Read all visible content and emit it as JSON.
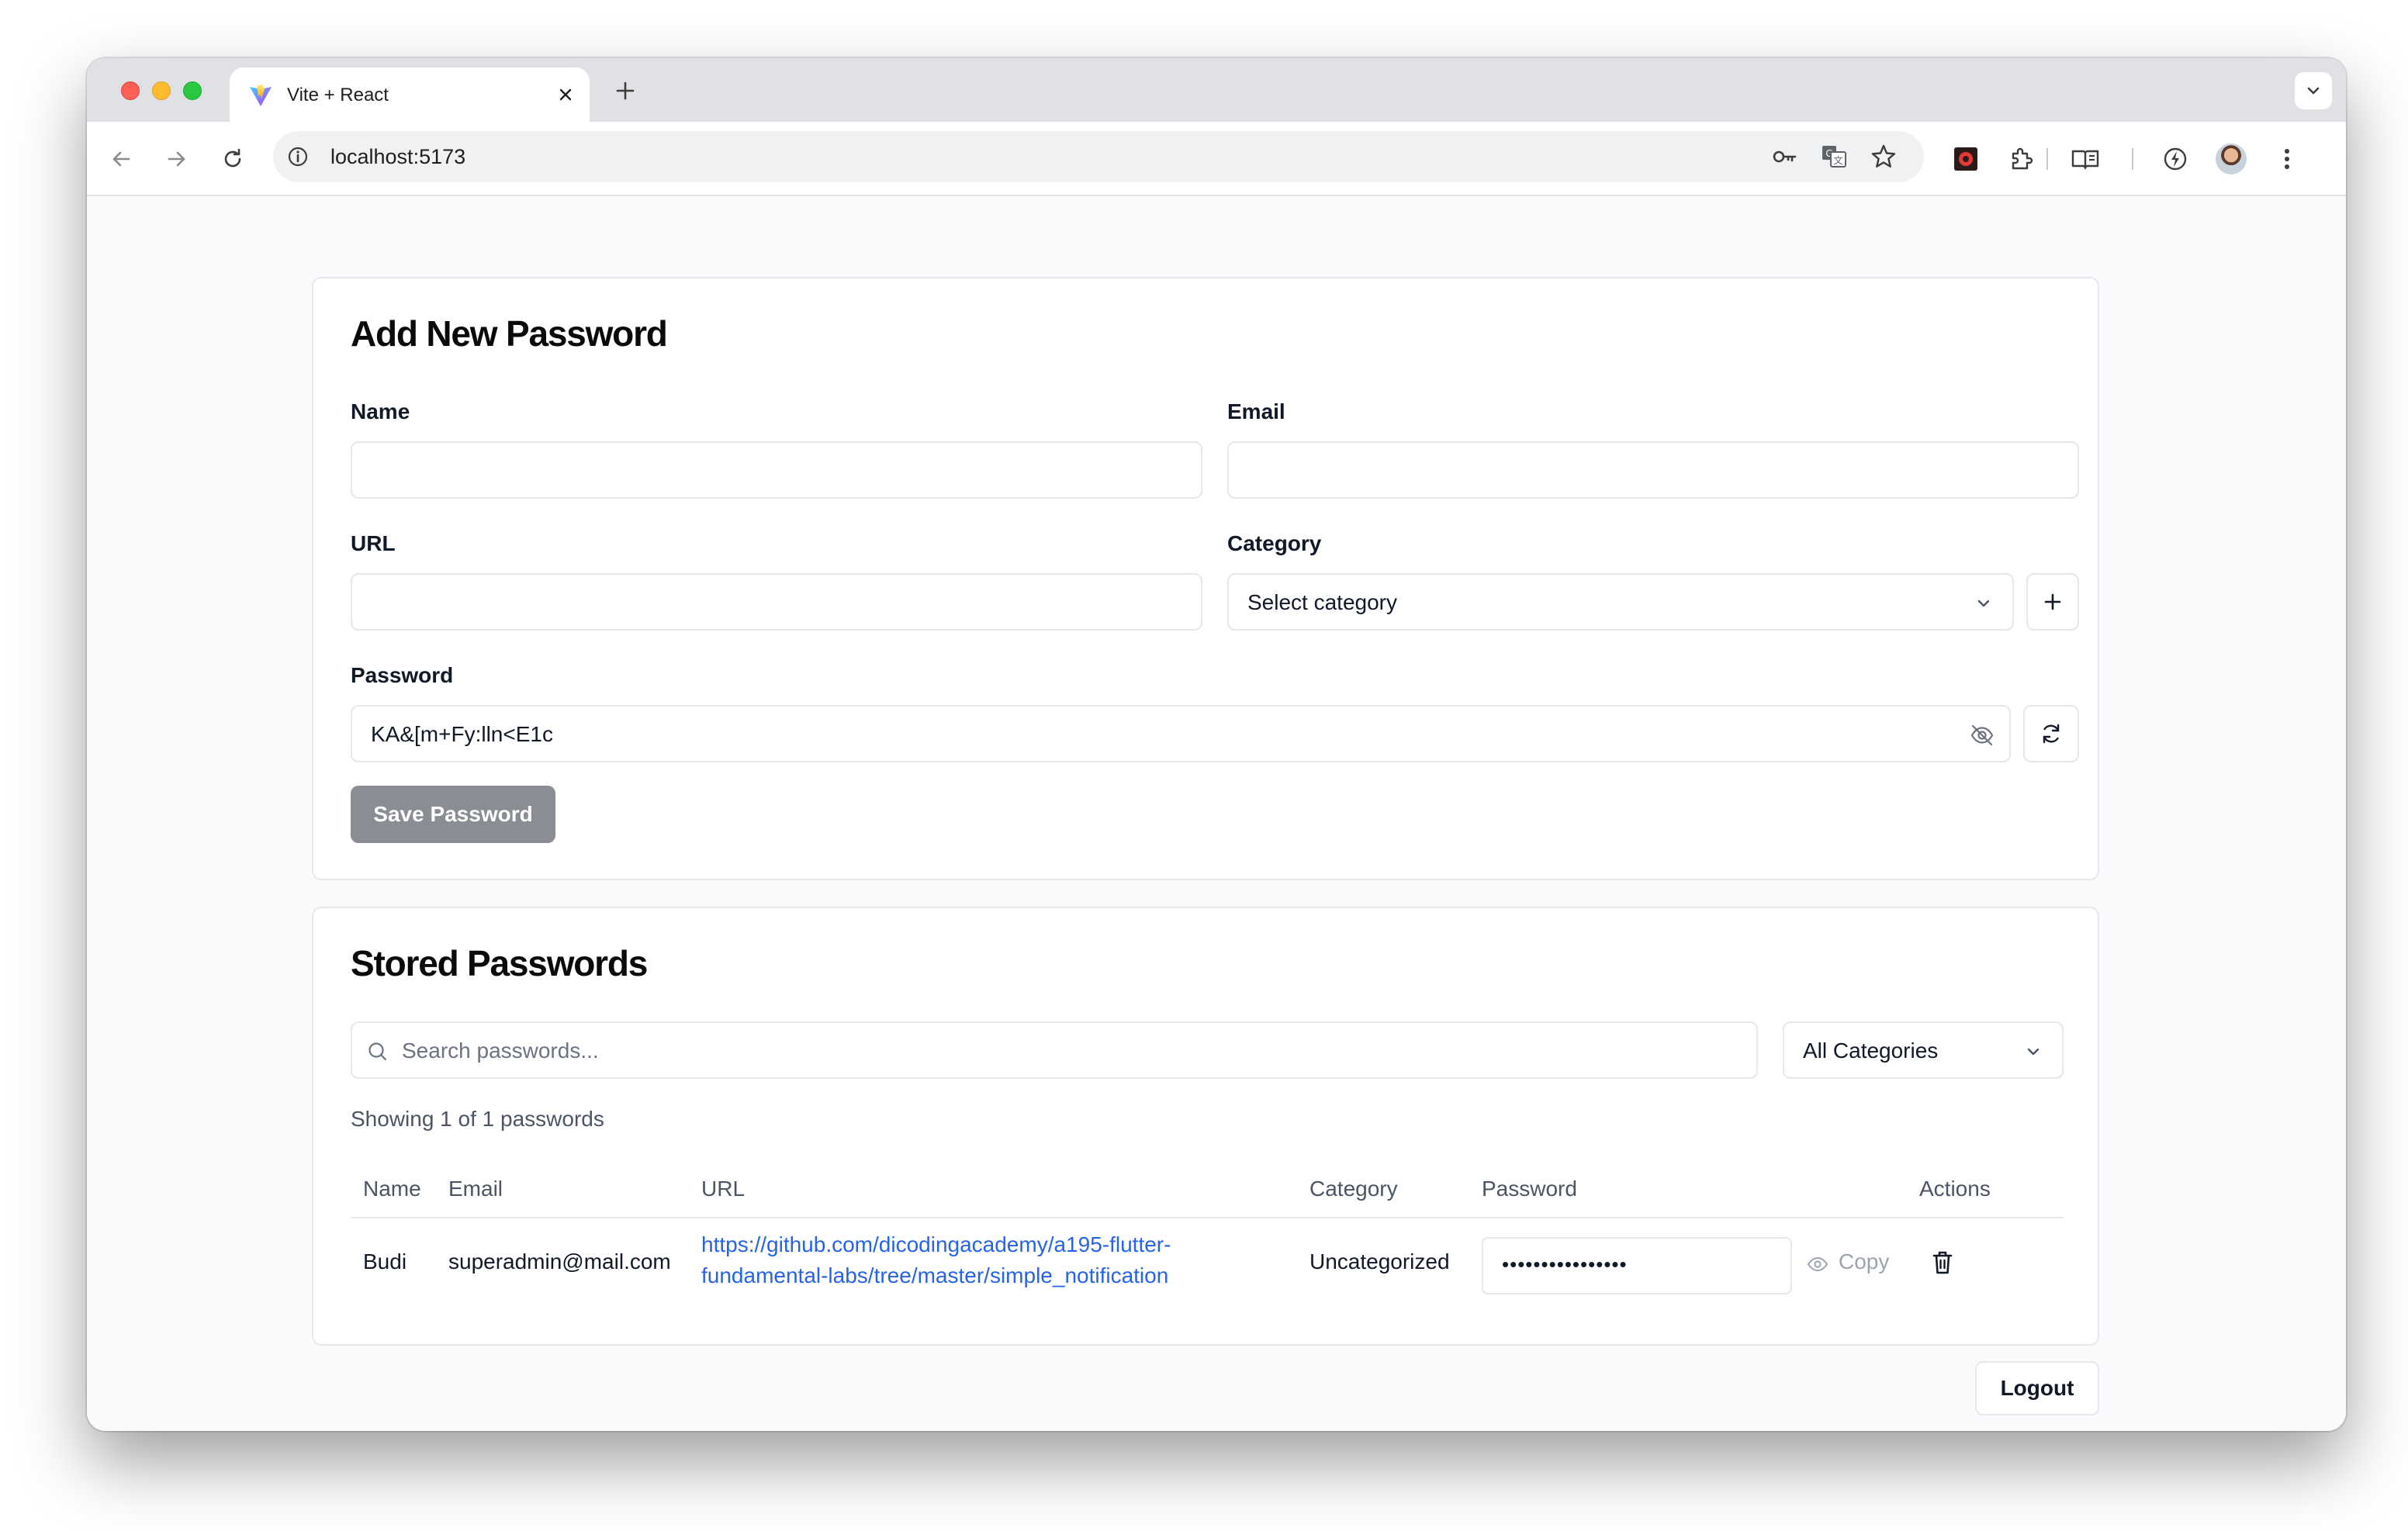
{
  "browser": {
    "tab_title": "Vite + React",
    "url": "localhost:5173"
  },
  "add_form": {
    "title": "Add New Password",
    "name_label": "Name",
    "name_value": "",
    "email_label": "Email",
    "email_value": "",
    "url_label": "URL",
    "url_value": "",
    "category_label": "Category",
    "category_selected": "Select category",
    "password_label": "Password",
    "password_value": "KA&[m+Fy:lln<E1c",
    "save_label": "Save Password"
  },
  "stored": {
    "title": "Stored Passwords",
    "search_placeholder": "Search passwords...",
    "filter_selected": "All Categories",
    "showing_text": "Showing 1 of 1 passwords",
    "columns": [
      "Name",
      "Email",
      "URL",
      "Category",
      "Password",
      "Actions"
    ],
    "rows": [
      {
        "name": "Budi",
        "email": "superadmin@mail.com",
        "url_line1": "https://github.com/dicodingacademy/a195-flutter-",
        "url_line2": "fundamental-labs/tree/master/simple_notification",
        "category": "Uncategorized",
        "password_masked": "••••••••••••••••",
        "copy_label": "Copy"
      }
    ]
  },
  "logout_label": "Logout",
  "colors": {
    "link": "#2563eb",
    "save_button": "#8a8d93",
    "border": "#e5e7eb",
    "page_bg": "#f9fafb"
  },
  "icons": [
    "vite-logo-icon",
    "close-icon",
    "plus-icon",
    "chevron-down-icon",
    "back-icon",
    "forward-icon",
    "reload-icon",
    "info-icon",
    "key-icon",
    "translate-icon",
    "star-icon",
    "extension-icon",
    "puzzle-icon",
    "reading-list-icon",
    "performance-icon",
    "menu-dots-icon",
    "eye-off-icon",
    "refresh-icon",
    "search-icon",
    "eye-icon",
    "trash-icon"
  ]
}
